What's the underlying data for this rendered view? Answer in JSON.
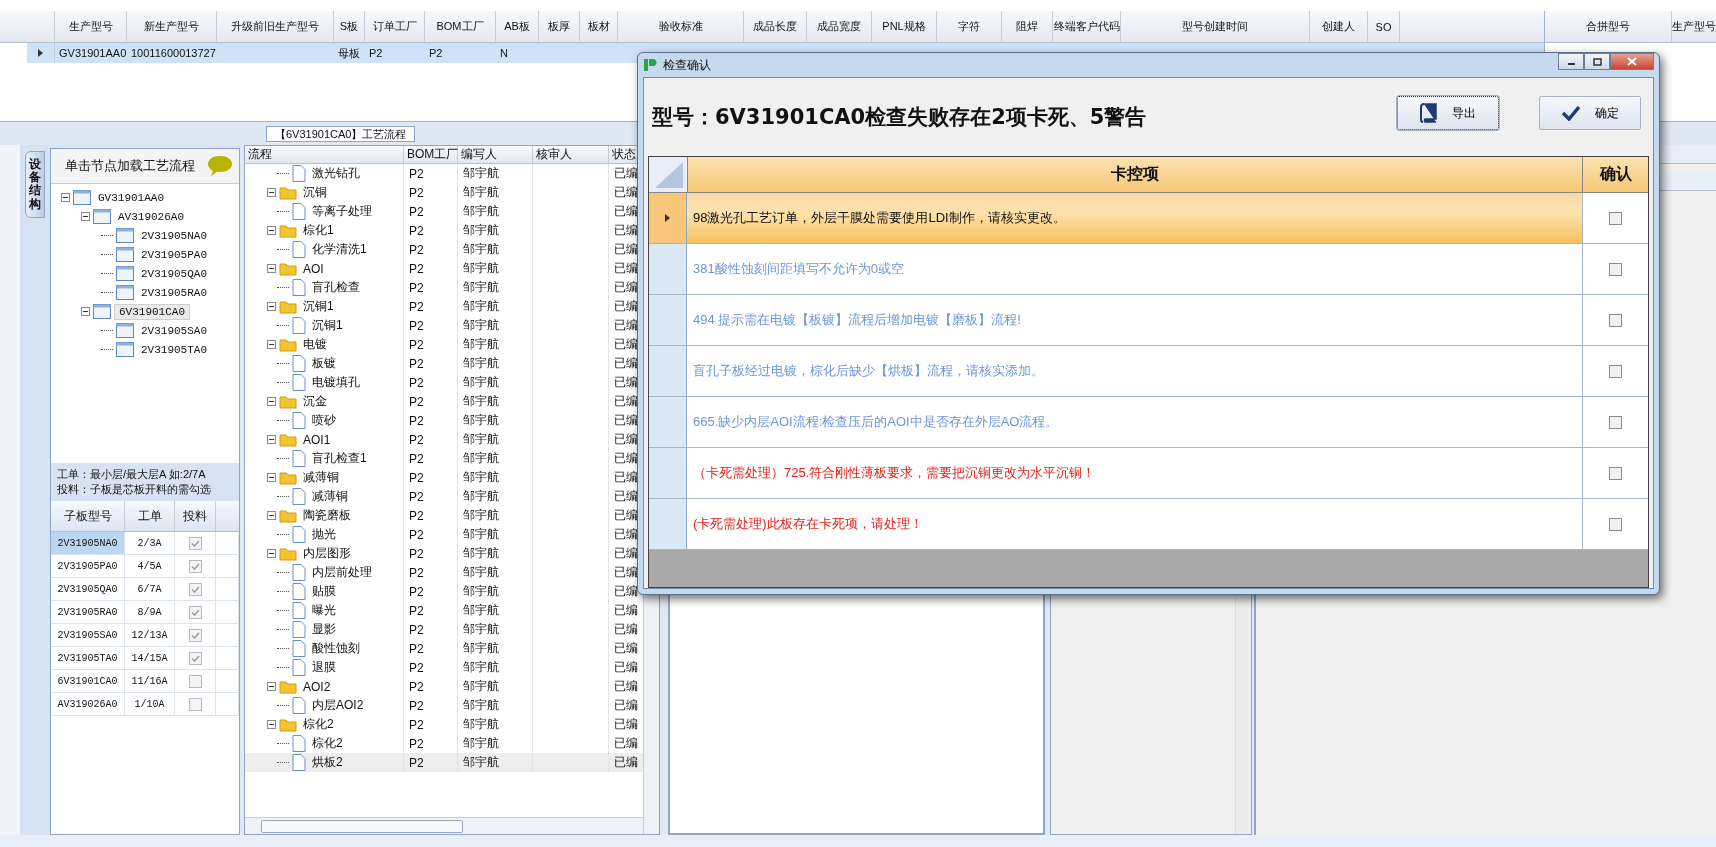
{
  "top_grid": {
    "columns": [
      "生产型号",
      "新生产型号",
      "升级前旧生产型号",
      "S板",
      "订单工厂",
      "BOM工厂",
      "AB板",
      "板厚",
      "板材",
      "验收标准",
      "成品长度",
      "成品宽度",
      "PNL规格",
      "字符",
      "阻焊",
      "终端客户代码",
      "型号创建时间",
      "创建人",
      "SO"
    ],
    "rows": [
      {
        "selected": true,
        "cells": [
          "GV31901AA0",
          "10011600013727",
          null,
          "母板",
          "P2",
          "P2",
          "N"
        ]
      }
    ]
  },
  "merge_grid": {
    "columns": [
      "合拼型号",
      "生产型号"
    ]
  },
  "flow_tab": {
    "label": "【6V31901CA0】工艺流程"
  },
  "left_panel": {
    "tab_label": "设备结构",
    "hint": "单击节点加载工艺流程",
    "device_tree": [
      {
        "label": "GV31901AA0",
        "expanded": true,
        "selected": false,
        "children": [
          {
            "label": "AV319026A0",
            "expanded": true,
            "selected": false,
            "children": [
              {
                "label": "2V31905NA0",
                "selected": false
              },
              {
                "label": "2V31905PA0",
                "selected": false
              },
              {
                "label": "2V31905QA0",
                "selected": false
              },
              {
                "label": "2V31905RA0",
                "selected": false
              }
            ]
          },
          {
            "label": "6V31901CA0",
            "expanded": true,
            "selected": true,
            "children": [
              {
                "label": "2V31905SA0",
                "selected": false
              },
              {
                "label": "2V31905TA0",
                "selected": false
              }
            ]
          }
        ]
      }
    ],
    "notes": [
      "工单：最小层/最大层A 如:2/7A",
      "投料：子板是芯板开料的需勾选"
    ],
    "sub_boards": {
      "columns": [
        "子板型号",
        "工单",
        "投料"
      ],
      "rows": [
        {
          "model": "2V31905NA0",
          "order": "2/3A",
          "checked": true,
          "selected": true
        },
        {
          "model": "2V31905PA0",
          "order": "4/5A",
          "checked": true,
          "selected": false
        },
        {
          "model": "2V31905QA0",
          "order": "6/7A",
          "checked": true,
          "selected": false
        },
        {
          "model": "2V31905RA0",
          "order": "8/9A",
          "checked": true,
          "selected": false
        },
        {
          "model": "2V31905SA0",
          "order": "12/13A",
          "checked": true,
          "selected": false
        },
        {
          "model": "2V31905TA0",
          "order": "14/15A",
          "checked": true,
          "selected": false
        },
        {
          "model": "6V31901CA0",
          "order": "11/16A",
          "checked": false,
          "selected": false
        },
        {
          "model": "AV319026A0",
          "order": "1/10A",
          "checked": false,
          "selected": false
        }
      ]
    }
  },
  "process_tree": {
    "columns": [
      "流程",
      "BOM工厂",
      "编写人",
      "核审人",
      "状态"
    ],
    "nodes": [
      {
        "kind": "file",
        "name": "激光钻孔",
        "bom": "P2",
        "author": "邹宇航",
        "status": "已编",
        "selected": false
      },
      {
        "kind": "folder",
        "name": "沉铜",
        "bom": "P2",
        "author": "邹宇航",
        "status": "已编",
        "expanded": true,
        "selected": false,
        "children": [
          {
            "kind": "file",
            "name": "等离子处理",
            "bom": "P2",
            "author": "邹宇航",
            "status": "已编",
            "selected": false
          }
        ]
      },
      {
        "kind": "folder",
        "name": "棕化1",
        "bom": "P2",
        "author": "邹宇航",
        "status": "已编",
        "expanded": true,
        "selected": false,
        "children": [
          {
            "kind": "file",
            "name": "化学清洗1",
            "bom": "P2",
            "author": "邹宇航",
            "status": "已编",
            "selected": false
          }
        ]
      },
      {
        "kind": "folder",
        "name": "AOI",
        "bom": "P2",
        "author": "邹宇航",
        "status": "已编",
        "expanded": true,
        "selected": false,
        "children": [
          {
            "kind": "file",
            "name": "盲孔检查",
            "bom": "P2",
            "author": "邹宇航",
            "status": "已编",
            "selected": false
          }
        ]
      },
      {
        "kind": "folder",
        "name": "沉铜1",
        "bom": "P2",
        "author": "邹宇航",
        "status": "已编",
        "expanded": true,
        "selected": false,
        "children": [
          {
            "kind": "file",
            "name": "沉铜1",
            "bom": "P2",
            "author": "邹宇航",
            "status": "已编",
            "selected": false
          }
        ]
      },
      {
        "kind": "folder",
        "name": "电镀",
        "bom": "P2",
        "author": "邹宇航",
        "status": "已编",
        "expanded": true,
        "selected": false,
        "children": [
          {
            "kind": "file",
            "name": "板镀",
            "bom": "P2",
            "author": "邹宇航",
            "status": "已编",
            "selected": false
          },
          {
            "kind": "file",
            "name": "电镀填孔",
            "bom": "P2",
            "author": "邹宇航",
            "status": "已编",
            "selected": false
          }
        ]
      },
      {
        "kind": "folder",
        "name": "沉金",
        "bom": "P2",
        "author": "邹宇航",
        "status": "已编",
        "expanded": true,
        "selected": false,
        "children": [
          {
            "kind": "file",
            "name": "喷砂",
            "bom": "P2",
            "author": "邹宇航",
            "status": "已编",
            "selected": false
          }
        ]
      },
      {
        "kind": "folder",
        "name": "AOI1",
        "bom": "P2",
        "author": "邹宇航",
        "status": "已编",
        "expanded": true,
        "selected": false,
        "children": [
          {
            "kind": "file",
            "name": "盲孔检查1",
            "bom": "P2",
            "author": "邹宇航",
            "status": "已编",
            "selected": false
          }
        ]
      },
      {
        "kind": "folder",
        "name": "减薄铜",
        "bom": "P2",
        "author": "邹宇航",
        "status": "已编",
        "expanded": true,
        "selected": false,
        "children": [
          {
            "kind": "file",
            "name": "减薄铜",
            "bom": "P2",
            "author": "邹宇航",
            "status": "已编",
            "selected": false
          }
        ]
      },
      {
        "kind": "folder",
        "name": "陶瓷磨板",
        "bom": "P2",
        "author": "邹宇航",
        "status": "已编",
        "expanded": true,
        "selected": false,
        "children": [
          {
            "kind": "file",
            "name": "抛光",
            "bom": "P2",
            "author": "邹宇航",
            "status": "已编",
            "selected": false
          }
        ]
      },
      {
        "kind": "folder",
        "name": "内层图形",
        "bom": "P2",
        "author": "邹宇航",
        "status": "已编",
        "expanded": true,
        "selected": false,
        "children": [
          {
            "kind": "file",
            "name": "内层前处理",
            "bom": "P2",
            "author": "邹宇航",
            "status": "已编",
            "selected": false
          },
          {
            "kind": "file",
            "name": "贴膜",
            "bom": "P2",
            "author": "邹宇航",
            "status": "已编",
            "selected": false
          },
          {
            "kind": "file",
            "name": "曝光",
            "bom": "P2",
            "author": "邹宇航",
            "status": "已编",
            "selected": false
          },
          {
            "kind": "file",
            "name": "显影",
            "bom": "P2",
            "author": "邹宇航",
            "status": "已编",
            "selected": false
          },
          {
            "kind": "file",
            "name": "酸性蚀刻",
            "bom": "P2",
            "author": "邹宇航",
            "status": "已编",
            "selected": false
          },
          {
            "kind": "file",
            "name": "退膜",
            "bom": "P2",
            "author": "邹宇航",
            "status": "已编",
            "selected": false
          }
        ]
      },
      {
        "kind": "folder",
        "name": "AOI2",
        "bom": "P2",
        "author": "邹宇航",
        "status": "已编",
        "expanded": true,
        "selected": false,
        "children": [
          {
            "kind": "file",
            "name": "内层AOI2",
            "bom": "P2",
            "author": "邹宇航",
            "status": "已编",
            "selected": false
          }
        ]
      },
      {
        "kind": "folder",
        "name": "棕化2",
        "bom": "P2",
        "author": "邹宇航",
        "status": "已编",
        "expanded": true,
        "selected": false,
        "children": [
          {
            "kind": "file",
            "name": "棕化2",
            "bom": "P2",
            "author": "邹宇航",
            "status": "已编",
            "selected": false
          },
          {
            "kind": "file",
            "name": "烘板2",
            "bom": "P2",
            "author": "邹宇航",
            "status": "已编",
            "selected": true
          }
        ]
      }
    ]
  },
  "dialog": {
    "title": "检查确认",
    "heading": "型号：6V31901CA0检查失败存在2项卡死、5警告",
    "buttons": [
      {
        "kind": "export",
        "label": "导出"
      },
      {
        "kind": "confirm",
        "label": "确定"
      }
    ],
    "columns": [
      "卡控项",
      "确认"
    ],
    "items": [
      {
        "kind": "warning",
        "selected": true,
        "checked": false,
        "text": "98激光孔工艺订单，外层干膜处需要使用LDI制作，请核实更改。"
      },
      {
        "kind": "warning",
        "selected": false,
        "checked": false,
        "text": "381酸性蚀刻间距填写不允许为0或空"
      },
      {
        "kind": "warning",
        "selected": false,
        "checked": false,
        "text": "494 提示需在电镀【板镀】流程后增加电镀【磨板】流程!"
      },
      {
        "kind": "warning",
        "selected": false,
        "checked": false,
        "text": "盲孔子板经过电镀，棕化后缺少【烘板】流程，请核实添加。"
      },
      {
        "kind": "warning",
        "selected": false,
        "checked": false,
        "text": "665.缺少内层AOI流程:检查压后的AOI中是否存在外层AO流程。"
      },
      {
        "kind": "blocking",
        "selected": false,
        "checked": false,
        "text": "（卡死需处理）725.符合刚性薄板要求，需要把沉铜更改为水平沉铜！"
      },
      {
        "kind": "blocking",
        "selected": false,
        "checked": false,
        "text": "(卡死需处理)此板存在卡死项，请处理！"
      }
    ]
  }
}
